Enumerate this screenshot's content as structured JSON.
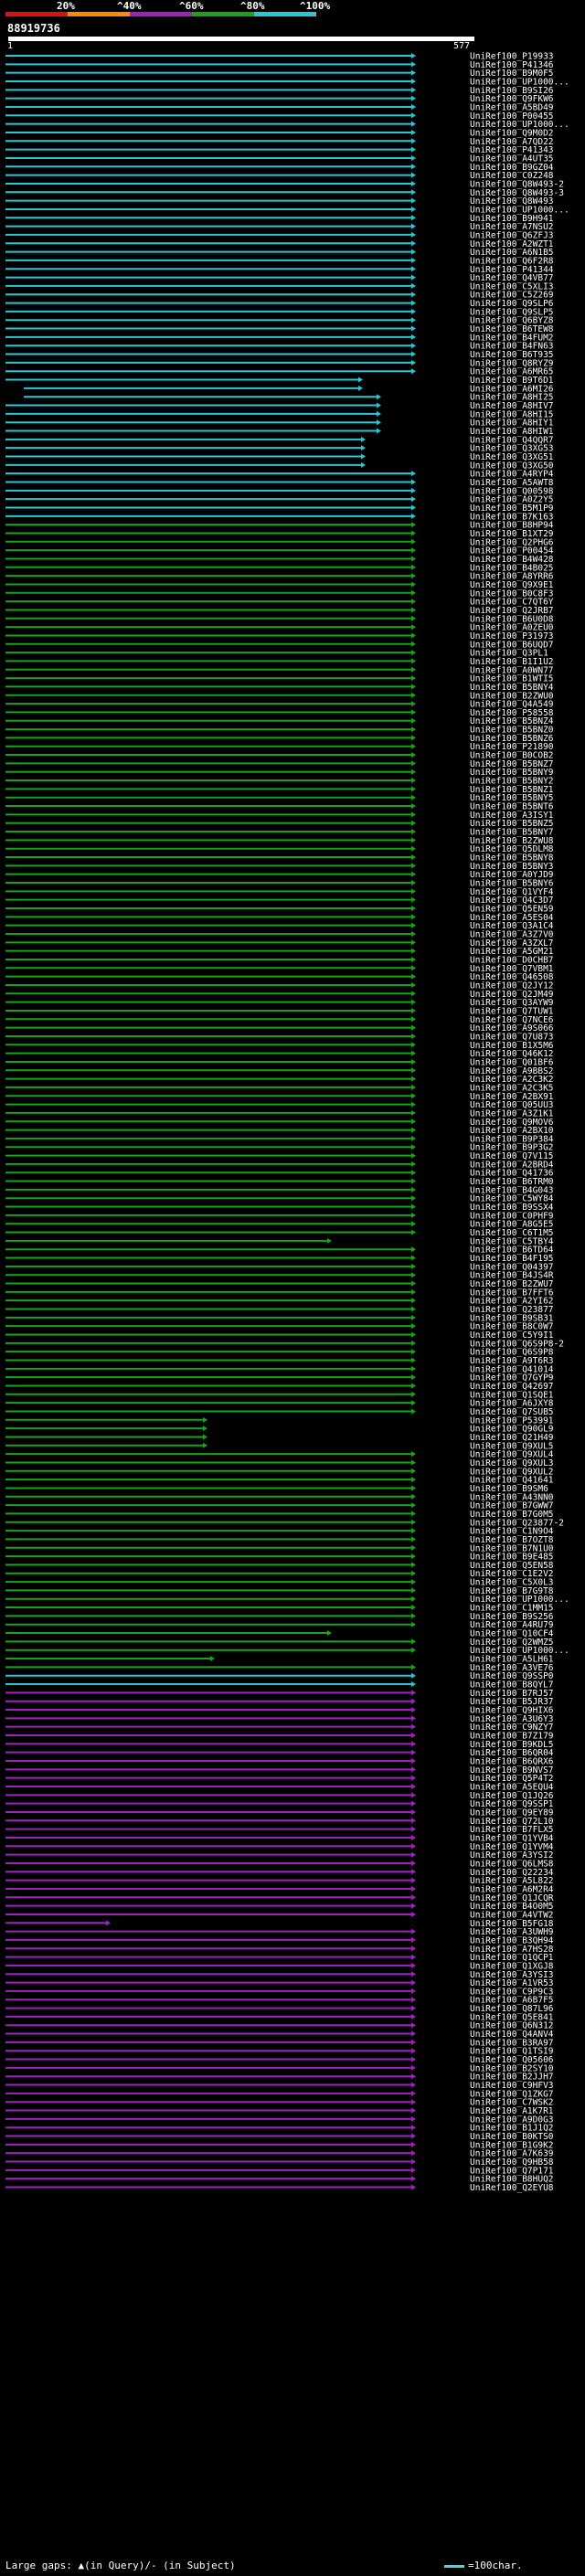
{
  "legend": {
    "labels": [
      "20%",
      "^40%",
      "^60%",
      "^80%",
      "^100%"
    ],
    "colors": [
      "#e01010",
      "#ff8a00",
      "#a020c0",
      "#19a319",
      "#29c7d6"
    ]
  },
  "query": {
    "id": "88919736",
    "start": "1",
    "end": "577"
  },
  "hits": [
    "UniRef100_P19933",
    "UniRef100_P41346",
    "UniRef100_B9M0F5",
    "UniRef100_UP1000...",
    "UniRef100_B9SI26",
    "UniRef100_Q9FKW6",
    "UniRef100_A5BD49",
    "UniRef100_P00455",
    "UniRef100_UP1000...",
    "UniRef100_Q9M0D2",
    "UniRef100_A7QD22",
    "UniRef100_P41343",
    "UniRef100_A4UT35",
    "UniRef100_B9GZ04",
    "UniRef100_C0Z248",
    "UniRef100_Q8W493-2",
    "UniRef100_Q8W493-3",
    "UniRef100_Q8W493",
    "UniRef100_UP1000...",
    "UniRef100_B9H941",
    "UniRef100_A7NSU2",
    "UniRef100_Q6ZFJ3",
    "UniRef100_A2WZT1",
    "UniRef100_A6N1B5",
    "UniRef100_Q6F2R8",
    "UniRef100_P41344",
    "UniRef100_Q4VB77",
    "UniRef100_C5XLI3",
    "UniRef100_C5Z269",
    "UniRef100_Q9SLP6",
    "UniRef100_Q9SLP5",
    "UniRef100_Q6BYZ8",
    "UniRef100_B6TEW8",
    "UniRef100_B4FUM2",
    "UniRef100_B4FN63",
    "UniRef100_B6T935",
    "UniRef100_Q8RYZ9",
    "UniRef100_A6MR65",
    "UniRef100_B9T6D1",
    "UniRef100_A6MI26",
    "UniRef100_A8HI25",
    "UniRef100_A8HIV7",
    "UniRef100_A8HI15",
    "UniRef100_A8HIY1",
    "UniRef100_A8HIW1",
    "UniRef100_Q4QQR7",
    "UniRef100_Q3XG53",
    "UniRef100_Q3XG51",
    "UniRef100_Q3XG50",
    "UniRef100_A4RYP4",
    "UniRef100_A5AWT8",
    "UniRef100_Q00598",
    "UniRef100_A0Z2Y5",
    "UniRef100_B5M1P9",
    "UniRef100_B7K163",
    "UniRef100_B8HP94",
    "UniRef100_B1XT29",
    "UniRef100_Q2PHG6",
    "UniRef100_P00454",
    "UniRef100_B4W428",
    "UniRef100_B4B025",
    "UniRef100_A8YRR6",
    "UniRef100_Q9X9E1",
    "UniRef100_B0C8F3",
    "UniRef100_C7QT6Y",
    "UniRef100_Q2JRB7",
    "UniRef100_B6U0D8",
    "UniRef100_A0ZEU0",
    "UniRef100_P31973",
    "UniRef100_B6UQD7",
    "UniRef100_Q3PL1",
    "UniRef100_B1I1U2",
    "UniRef100_A0WN77",
    "UniRef100_B1WTI5",
    "UniRef100_B5BNY4",
    "UniRef100_B2ZWU0",
    "UniRef100_Q4A549",
    "UniRef100_P58558",
    "UniRef100_B5BNZ4",
    "UniRef100_B5BNZ0",
    "UniRef100_B5BNZ6",
    "UniRef100_P21890",
    "UniRef100_B0COB2",
    "UniRef100_B5BNZ7",
    "UniRef100_B5BNY9",
    "UniRef100_B5BNY2",
    "UniRef100_B5BNZ1",
    "UniRef100_B5BNY5",
    "UniRef100_B5BNT6",
    "UniRef100_A3ISY1",
    "UniRef100_B5BNZ5",
    "UniRef100_B5BNY7",
    "UniRef100_B2ZWU8",
    "UniRef100_Q5DLM8",
    "UniRef100_B5BNY8",
    "UniRef100_B5BNY3",
    "UniRef100_A0YJD9",
    "UniRef100_B5BNY6",
    "UniRef100_Q1VYF4",
    "UniRef100_Q4C3D7",
    "UniRef100_Q5EN59",
    "UniRef100_A5ES04",
    "UniRef100_Q3A1C4",
    "UniRef100_A3Z7V0",
    "UniRef100_A3ZXL7",
    "UniRef100_A5GM21",
    "UniRef100_D0CHB7",
    "UniRef100_Q7VBM1",
    "UniRef100_Q46508",
    "UniRef100_Q2JY12",
    "UniRef100_Q2JM49",
    "UniRef100_Q3AYW9",
    "UniRef100_Q7TUW1",
    "UniRef100_Q7NCE6",
    "UniRef100_A9S066",
    "UniRef100_Q7U873",
    "UniRef100_B1X5M6",
    "UniRef100_Q46K12",
    "UniRef100_Q01BF6",
    "UniRef100_A9BBS2",
    "UniRef100_A2C3K2",
    "UniRef100_A2C3K5",
    "UniRef100_A2BX91",
    "UniRef100_Q05UU3",
    "UniRef100_A3Z1K1",
    "UniRef100_Q9MOV6",
    "UniRef100_A2BX10",
    "UniRef100_B9P384",
    "UniRef100_B9P3G2",
    "UniRef100_Q7V115",
    "UniRef100_A2BRD4",
    "UniRef100_Q41736",
    "UniRef100_B6TRM0",
    "UniRef100_B4G043",
    "UniRef100_C5WY84",
    "UniRef100_B9SSX4",
    "UniRef100_C0PHF9",
    "UniRef100_A8G5E5",
    "UniRef100_C6T1M5",
    "UniRef100_C5TBY4",
    "UniRef100_B6TD64",
    "UniRef100_B4F195",
    "UniRef100_Q04397",
    "UniRef100_B4JS4R",
    "UniRef100_B2ZWU7",
    "UniRef100_B7FFT6",
    "UniRef100_A2YI62",
    "UniRef100_Q23877",
    "UniRef100_B9SB31",
    "UniRef100_B8C0W7",
    "UniRef100_C5Y9I1",
    "UniRef100_Q6S9P8-2",
    "UniRef100_Q6S9P8",
    "UniRef100_A9T6R3",
    "UniRef100_Q41014",
    "UniRef100_Q7GYP9",
    "UniRef100_Q42697",
    "UniRef100_Q1SQE1",
    "UniRef100_A6JXY8",
    "UniRef100_Q7SUB5",
    "UniRef100_P53991",
    "UniRef100_Q90GL9",
    "UniRef100_Q21H49",
    "UniRef100_Q9XUL5",
    "UniRef100_Q9XUL4",
    "UniRef100_Q9XUL3",
    "UniRef100_Q9XUL2",
    "UniRef100_Q41641",
    "UniRef100_B9SM6",
    "UniRef100_A43NN0",
    "UniRef100_B7GWW7",
    "UniRef100_B7G0M5",
    "UniRef100_Q23877-2",
    "UniRef100_C1N9O4",
    "UniRef100_B7OZT8",
    "UniRef100_B7N1U0",
    "UniRef100_B9E485",
    "UniRef100_Q5EN58",
    "UniRef100_C1E2V2",
    "UniRef100_C5X0L3",
    "UniRef100_B7G9T8",
    "UniRef100_UP1000...",
    "UniRef100_C1MM15",
    "UniRef100_B9S256",
    "UniRef100_A4RU79",
    "UniRef100_Q10CF4",
    "UniRef100_Q2WMZ5",
    "UniRef100_UP1000...",
    "UniRef100_A5LH61",
    "UniRef100_A3VE76",
    "UniRef100_Q9SSP0",
    "UniRef100_B8QYL7",
    "UniRef100_B7RJ57",
    "UniRef100_B5JR37",
    "UniRef100_Q9HIX6",
    "UniRef100_A3U6Y3",
    "UniRef100_C9NZY7",
    "UniRef100_B7Z179",
    "UniRef100_B9KDL5",
    "UniRef100_B6QR04",
    "UniRef100_B6QRX6",
    "UniRef100_B9NVS7",
    "UniRef100_Q5P4T2",
    "UniRef100_A5EQU4",
    "UniRef100_Q1JQ26",
    "UniRef100_Q9SSP1",
    "UniRef100_Q9EY89",
    "UniRef100_Q72L10",
    "UniRef100_B7FLX5",
    "UniRef100_Q1YVB4",
    "UniRef100_Q1YVM4",
    "UniRef100_A3YSI2",
    "UniRef100_Q6LMS8",
    "UniRef100_Q22234",
    "UniRef100_A5L822",
    "UniRef100_A6M2R4",
    "UniRef100_Q1JCQR",
    "UniRef100_B4O0M5",
    "UniRef100_A4VTW2",
    "UniRef100_B5FG18",
    "UniRef100_A3UWH9",
    "UniRef100_B3QH94",
    "UniRef100_A7HS28",
    "UniRef100_Q1QCP1",
    "UniRef100_Q1XGJ8",
    "UniRef100_A3YSI3",
    "UniRef100_A1VR53",
    "UniRef100_C9P9C3",
    "UniRef100_A6B7F5",
    "UniRef100_Q87L96",
    "UniRef100_Q5E841",
    "UniRef100_Q6N312",
    "UniRef100_Q4ANV4",
    "UniRef100_B3RA97",
    "UniRef100_Q1TSI9",
    "UniRef100_Q05606",
    "UniRef100_B2SY10",
    "UniRef100_B2JJH7",
    "UniRef100_C9HFV3",
    "UniRef100_Q1ZKG7",
    "UniRef100_C7WSK2",
    "UniRef100_A1K7R1",
    "UniRef100_A9D0G3",
    "UniRef100_B1J1Q2",
    "UniRef100_B0KTS0",
    "UniRef100_B1G9K2",
    "UniRef100_A7K639",
    "UniRef100_Q9HB58",
    "UniRef100_Q7P171",
    "UniRef100_B8HUQ2",
    "UniRef100_Q2EYU8"
  ],
  "footer": {
    "text": "Large gaps: ▲(in Query)/- (in Subject)",
    "scale": "=100char."
  }
}
